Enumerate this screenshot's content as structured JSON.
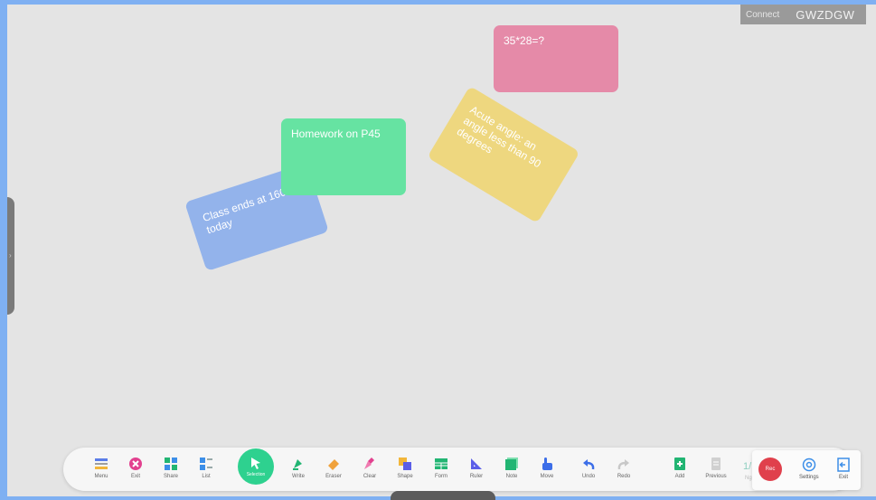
{
  "header": {
    "connect_label": "Connect",
    "room_code": "GWZDGW"
  },
  "notes": {
    "pink": "35*28=?",
    "green": "Homework on P45",
    "blue": "Class ends at 1600 today",
    "yellow": "Acute angle: an angle less than 90 degrees"
  },
  "toolbar": {
    "menu": "Menu",
    "exit": "Exit",
    "share": "Share",
    "list": "List",
    "selection": "Selection",
    "write": "Write",
    "eraser": "Eraser",
    "clear": "Clear",
    "shape": "Shape",
    "form": "Form",
    "ruler": "Ruler",
    "note": "Note",
    "move": "Move",
    "undo": "Undo",
    "redo": "Redo",
    "add": "Add",
    "previous": "Previous",
    "page_count": "1/1",
    "page_sub": "Ng"
  },
  "right_panel": {
    "rec_label": "Rec",
    "settings": "Settings",
    "exit": "Exit"
  },
  "colors": {
    "accent": "#2ed18f",
    "note_pink": "#e58aa8",
    "note_green": "#66e3a2",
    "note_blue": "#93b3eb",
    "note_yellow": "#eed77f",
    "record": "#e0404c"
  }
}
